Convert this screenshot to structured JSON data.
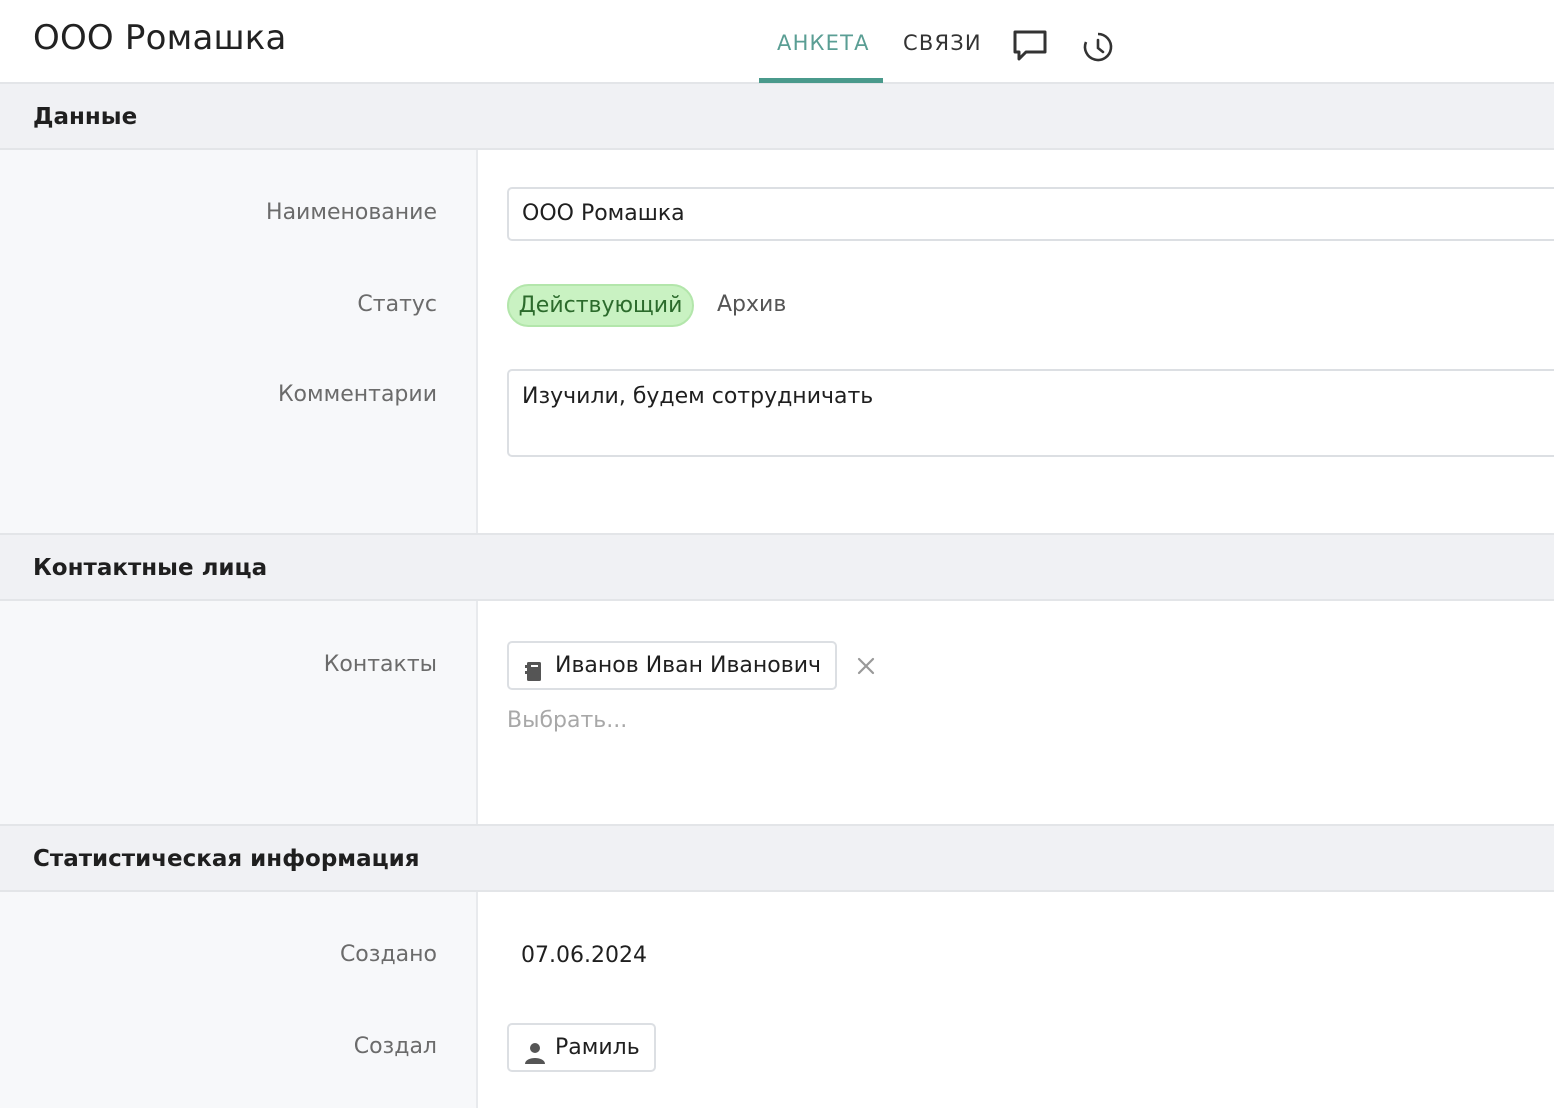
{
  "header": {
    "title": "ООО Ромашка",
    "tabs": [
      {
        "label": "АНКЕТА",
        "active": true
      },
      {
        "label": "СВЯЗИ",
        "active": false
      }
    ],
    "icons": [
      "comment-icon",
      "history-icon"
    ],
    "accent_color": "#4a9a8c"
  },
  "sections": {
    "data": {
      "title": "Данные",
      "name_label": "Наименование",
      "name_value": "ООО Ромашка",
      "status_label": "Статус",
      "status_options": [
        "Действующий",
        "Архив"
      ],
      "status_selected": "Действующий",
      "comment_label": "Комментарии",
      "comment_value": "Изучили, будем сотрудничать"
    },
    "contacts": {
      "title": "Контактные лица",
      "contacts_label": "Контакты",
      "contact_name": "Иванов Иван Иванович",
      "select_placeholder": "Выбрать..."
    },
    "stats": {
      "title": "Статистическая информация",
      "created_label": "Создано",
      "created_value": "07.06.2024",
      "author_label": "Создал",
      "author_value": "Рамиль"
    }
  }
}
